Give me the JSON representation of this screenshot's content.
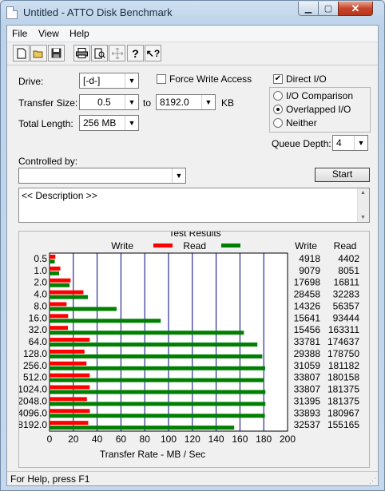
{
  "window": {
    "title": "Untitled - ATTO Disk Benchmark"
  },
  "menu": {
    "file": "File",
    "view": "View",
    "help": "Help"
  },
  "toolbar": [
    "new-icon",
    "open-icon",
    "save-icon",
    "print-icon",
    "print-preview-icon",
    "move-icon",
    "help-icon",
    "context-help-icon"
  ],
  "settings": {
    "drive_label": "Drive:",
    "drive_value": "[-d-]",
    "force_write_label": "Force Write Access",
    "force_write_checked": false,
    "direct_io_label": "Direct I/O",
    "direct_io_checked": true,
    "transfer_size_label": "Transfer Size:",
    "transfer_from": "0.5",
    "to_label": "to",
    "transfer_to": "8192.0",
    "kb_label": "KB",
    "total_length_label": "Total Length:",
    "total_length_value": "256 MB",
    "io_comparison_label": "I/O Comparison",
    "overlapped_label": "Overlapped I/O",
    "neither_label": "Neither",
    "selected_mode": "Overlapped I/O",
    "queue_depth_label": "Queue Depth:",
    "queue_depth_value": "4",
    "controlled_by_label": "Controlled by:",
    "controlled_by_value": "",
    "start_label": "Start",
    "description": "<< Description >>"
  },
  "results": {
    "title": "Test Results",
    "legend_write": "Write",
    "legend_read": "Read",
    "col_write": "Write",
    "col_read": "Read",
    "write_color": "#ff0000",
    "read_color": "#008000"
  },
  "chart_data": {
    "type": "bar",
    "orientation": "horizontal",
    "xlabel": "Transfer Rate - MB / Sec",
    "xlim": [
      0,
      200
    ],
    "xticks": [
      0,
      20,
      40,
      60,
      80,
      100,
      120,
      140,
      160,
      180,
      200
    ],
    "grid": true,
    "legend_placement": "top",
    "categories": [
      "0.5",
      "1.0",
      "2.0",
      "4.0",
      "8.0",
      "16.0",
      "32.0",
      "64.0",
      "128.0",
      "256.0",
      "512.0",
      "1024.0",
      "2048.0",
      "4096.0",
      "8192.0"
    ],
    "series": [
      {
        "name": "Write",
        "values": [
          4918,
          9079,
          17698,
          28458,
          14326,
          15641,
          15456,
          33781,
          29388,
          31059,
          33807,
          33807,
          31395,
          33893,
          32537
        ]
      },
      {
        "name": "Read",
        "values": [
          4402,
          8051,
          16811,
          32283,
          56357,
          93444,
          163311,
          174637,
          178750,
          181182,
          180158,
          181375,
          181375,
          180967,
          155165
        ]
      }
    ]
  },
  "status": {
    "text": "For Help, press F1"
  }
}
